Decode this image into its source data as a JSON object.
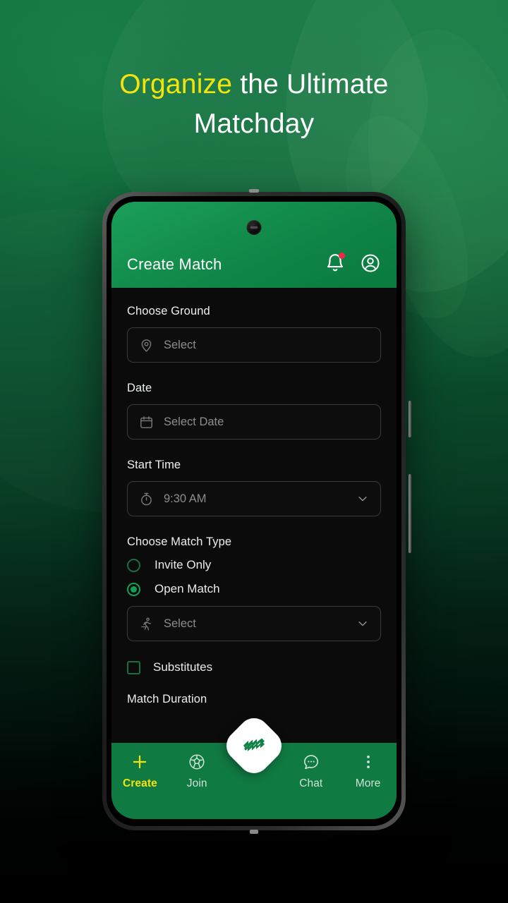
{
  "poster": {
    "headline_accent": "Organize",
    "headline_rest": " the Ultimate",
    "headline_line2": "Matchday",
    "accent_color": "#f4e40c",
    "bg_top_color": "#13733f",
    "bg_bottom_color": "#000000"
  },
  "app": {
    "header": {
      "title": "Create Match",
      "notification_icon": "bell-icon",
      "notification_badge": true,
      "profile_icon": "user-circle-icon",
      "brand_green": "#0f8446"
    },
    "form": {
      "ground": {
        "label": "Choose Ground",
        "placeholder": "Select",
        "icon": "location-pin-icon"
      },
      "date": {
        "label": "Date",
        "placeholder": "Select Date",
        "icon": "calendar-icon"
      },
      "start_time": {
        "label": "Start Time",
        "value": "9:30 AM",
        "icon": "stopwatch-icon",
        "chevron": "chevron-down-icon"
      },
      "match_type": {
        "label": "Choose Match Type",
        "options": [
          {
            "label": "Invite Only",
            "selected": false
          },
          {
            "label": "Open Match",
            "selected": true
          }
        ],
        "selected_color": "#12a053"
      },
      "format": {
        "placeholder": "Select",
        "icon": "running-person-icon",
        "chevron": "chevron-down-icon"
      },
      "substitutes": {
        "label": "Substitutes",
        "checked": false
      },
      "match_duration": {
        "label": "Match Duration"
      }
    },
    "bottom_nav": {
      "items": [
        {
          "label": "Create",
          "icon": "plus-icon",
          "active": true
        },
        {
          "label": "Join",
          "icon": "soccer-ball-icon",
          "active": false
        },
        {
          "label": "Chat",
          "icon": "chat-bubble-icon",
          "active": false
        },
        {
          "label": "More",
          "icon": "more-vertical-icon",
          "active": false
        }
      ],
      "active_color": "#f4e40c",
      "inactive_color": "#cfe3d6",
      "bar_color": "#107a43"
    },
    "fab": {
      "icon": "pitch-logo-icon",
      "shape": "rotated-rounded-square"
    }
  }
}
